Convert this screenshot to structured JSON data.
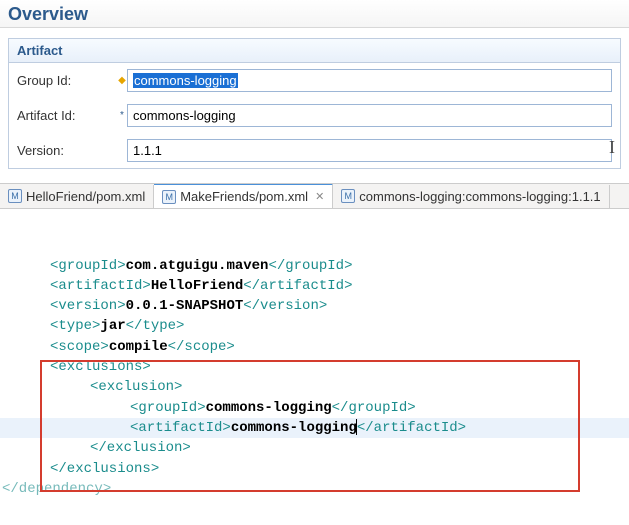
{
  "overview": {
    "title": "Overview"
  },
  "artifact": {
    "panel_title": "Artifact",
    "fields": {
      "group_id": {
        "label": "Group Id:",
        "value": "commons-logging"
      },
      "artifact_id": {
        "label": "Artifact Id:",
        "value": "commons-logging"
      },
      "version": {
        "label": "Version:",
        "value": "1.1.1"
      }
    }
  },
  "tabs": {
    "items": [
      {
        "icon": "M",
        "label": "HelloFriend/pom.xml",
        "active": false,
        "closable": false
      },
      {
        "icon": "M",
        "label": "MakeFriends/pom.xml",
        "active": true,
        "closable": true
      },
      {
        "icon": "M",
        "label": "commons-logging:commons-logging:1.1.1",
        "active": false,
        "closable": false
      }
    ]
  },
  "code": {
    "lines": [
      {
        "indent": 1,
        "open": "<groupId>",
        "text": "com.atguigu.maven",
        "close": "</groupId>"
      },
      {
        "indent": 1,
        "open": "<artifactId>",
        "text": "HelloFriend",
        "close": "</artifactId>"
      },
      {
        "indent": 1,
        "open": "<version>",
        "text": "0.0.1-SNAPSHOT",
        "close": "</version>"
      },
      {
        "indent": 1,
        "open": "<type>",
        "text": "jar",
        "close": "</type>"
      },
      {
        "indent": 1,
        "open": "<scope>",
        "text": "compile",
        "close": "</scope>"
      },
      {
        "indent": 1,
        "open": "<exclusions>",
        "text": "",
        "close": ""
      },
      {
        "indent": 2,
        "open": "<exclusion>",
        "text": "",
        "close": ""
      },
      {
        "indent": 3,
        "open": "<groupId>",
        "text": "commons-logging",
        "close": "</groupId>"
      },
      {
        "indent": 3,
        "open": "<artifactId>",
        "text": "commons-logging",
        "close": "</artifactId>",
        "highlight": true,
        "caret": true
      },
      {
        "indent": 2,
        "open": "</exclusion>",
        "text": "",
        "close": ""
      },
      {
        "indent": 1,
        "open": "</exclusions>",
        "text": "",
        "close": ""
      }
    ],
    "footer": "</dependency>"
  }
}
